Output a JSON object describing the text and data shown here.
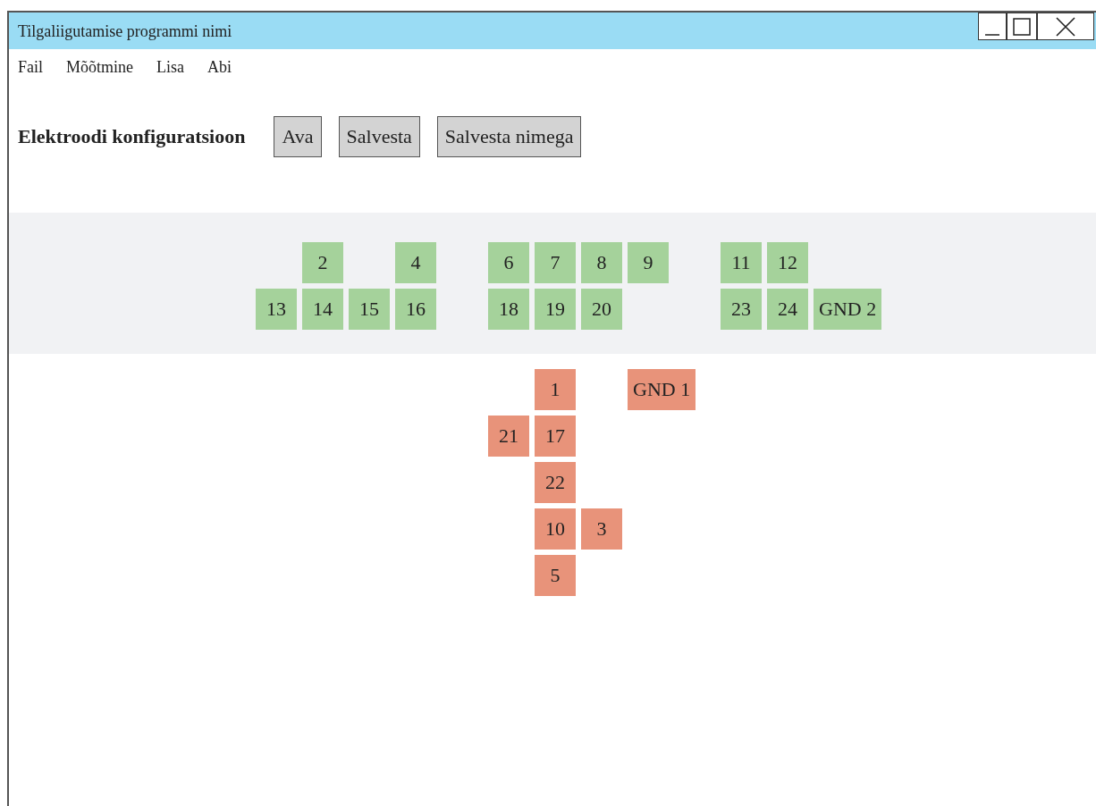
{
  "window": {
    "title": "Tilgaliigutamise programmi nimi"
  },
  "menu": [
    {
      "label": "Fail"
    },
    {
      "label": "Mõõtmine"
    },
    {
      "label": "Lisa"
    },
    {
      "label": "Abi"
    }
  ],
  "toolbar": {
    "heading": "Elektroodi konfiguratsioon",
    "buttons": [
      "Ava",
      "Salvesta",
      "Salvesta nimega"
    ]
  },
  "electrode_groups": [
    {
      "color": "#a5d29b",
      "shaded": true,
      "rows": [
        [
          null,
          "2",
          null,
          "4",
          null,
          "6",
          "7",
          "8",
          "9",
          null,
          "11",
          "12"
        ],
        [
          "13",
          "14",
          "15",
          "16",
          null,
          "18",
          "19",
          "20",
          null,
          null,
          "23",
          "24",
          "GND 2"
        ]
      ]
    },
    {
      "color": "#e8937a",
      "shaded": false,
      "rows": [
        [
          null,
          null,
          null,
          null,
          null,
          null,
          "1",
          null,
          "GND 1"
        ],
        [
          null,
          null,
          null,
          null,
          null,
          "21",
          "17"
        ],
        [
          null,
          null,
          null,
          null,
          null,
          null,
          "22"
        ],
        [
          null,
          null,
          null,
          null,
          null,
          null,
          "10",
          "3"
        ],
        [
          null,
          null,
          null,
          null,
          null,
          null,
          "5"
        ]
      ]
    }
  ]
}
